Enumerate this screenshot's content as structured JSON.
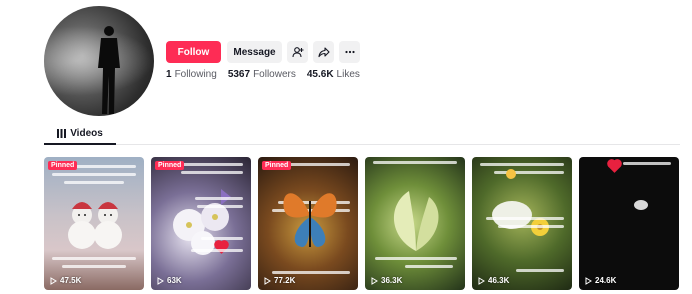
{
  "profile": {
    "follow_label": "Follow",
    "message_label": "Message",
    "add_friend_icon": "add-friend-icon",
    "share_icon": "share-icon",
    "more_icon": "more-icon"
  },
  "stats": {
    "following_count": "1",
    "following_label": "Following",
    "followers_count": "5367",
    "followers_label": "Followers",
    "likes_count": "45.6K",
    "likes_label": "Likes"
  },
  "tabs": {
    "videos_label": "Videos",
    "videos_icon": "grid-icon"
  },
  "videos": [
    {
      "pinned": "Pinned",
      "views": "47.5K"
    },
    {
      "pinned": "Pinned",
      "views": "63K"
    },
    {
      "pinned": "Pinned",
      "views": "77.2K"
    },
    {
      "pinned": "",
      "views": "36.3K"
    },
    {
      "pinned": "",
      "views": "46.3K"
    },
    {
      "pinned": "",
      "views": "24.6K"
    }
  ],
  "colors": {
    "accent": "#fe2c55",
    "text": "#161823",
    "secondary_button": "#f1f1f2"
  }
}
